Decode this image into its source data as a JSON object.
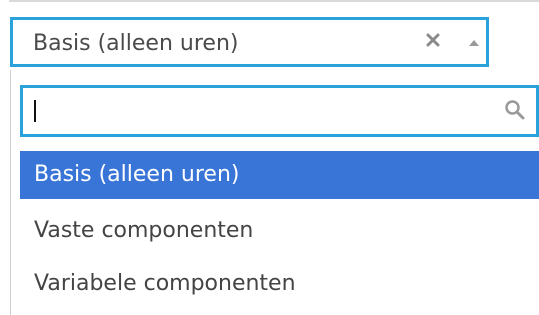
{
  "select": {
    "selected_value": "Basis (alleen uren)",
    "clear_icon": "close-icon",
    "toggle_icon": "triangle-up-icon"
  },
  "dropdown": {
    "search": {
      "value": "",
      "placeholder": "",
      "icon": "search-icon"
    },
    "options": [
      {
        "label": "Basis (alleen uren)",
        "highlighted": true
      },
      {
        "label": "Vaste componenten",
        "highlighted": false
      },
      {
        "label": "Variabele componenten",
        "highlighted": false
      }
    ]
  },
  "colors": {
    "focus_border": "#2aa2dc",
    "highlight_bg": "#3875d7",
    "highlight_text": "#ffffff",
    "text": "#444444"
  }
}
